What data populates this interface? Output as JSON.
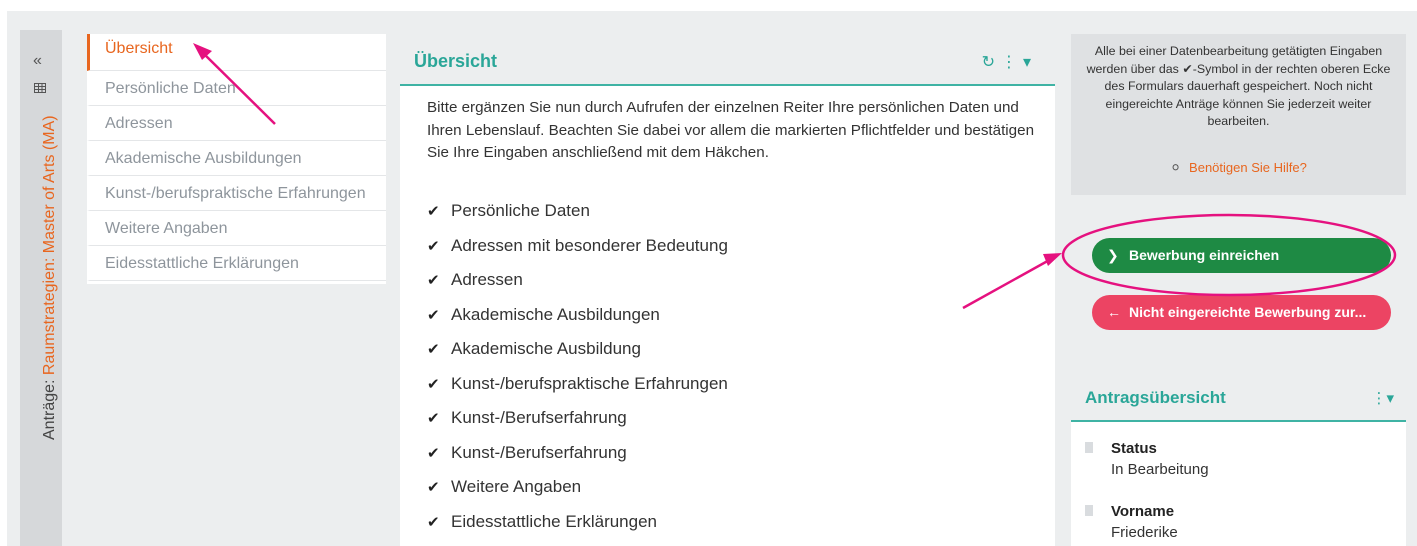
{
  "sidebar": {
    "collapse_icon": "double-chevron-left-icon",
    "grid_icon": "table-icon",
    "applications_label": "Anträge:",
    "program_name": "Raumstrategien: Master of Arts (MA)"
  },
  "nav": {
    "items": [
      {
        "label": "Übersicht",
        "active": true
      },
      {
        "label": "Persönliche Daten",
        "active": false
      },
      {
        "label": "Adressen",
        "active": false
      },
      {
        "label": "Akademische Ausbildungen",
        "active": false
      },
      {
        "label": "Kunst-/berufspraktische Erfahrungen",
        "active": false
      },
      {
        "label": "Weitere Angaben",
        "active": false
      },
      {
        "label": "Eidesstattliche Erklärungen",
        "active": false
      }
    ]
  },
  "main": {
    "title": "Übersicht",
    "tools": {
      "reload_icon": "reload-icon",
      "menu_icon": "kebab-menu-icon"
    },
    "intro": "Bitte ergänzen Sie nun durch Aufrufen der einzelnen Reiter Ihre persönlichen Daten und Ihren Lebenslauf. Beachten Sie dabei vor allem die markierten Pflichtfelder und bestätigen Sie Ihre Eingaben anschließend mit dem Häkchen.",
    "checklist": [
      "Persönliche Daten",
      "Adressen mit besonderer Bedeutung",
      "Adressen",
      "Akademische Ausbildungen",
      "Akademische Ausbildung",
      "Kunst-/berufspraktische Erfahrungen",
      "Kunst-/Berufserfahrung",
      "Kunst-/Berufserfahrung",
      "Weitere Angaben",
      "Eidesstattliche Erklärungen"
    ]
  },
  "info": {
    "text_before": "Alle bei einer Datenbearbeitung getätigten Eingaben werden über das",
    "check_glyph": "✔",
    "text_after": "-Symbol in der rechten oberen Ecke des Formulars dauerhaft gespeichert. Noch nicht eingereichte Anträge können Sie jederzeit weiter bearbeiten.",
    "help_label": "Benötigen Sie Hilfe?"
  },
  "actions": {
    "submit_label": "Bewerbung einreichen",
    "back_label": "Nicht eingereichte Bewerbung zur..."
  },
  "summary": {
    "title": "Antragsübersicht",
    "fields": [
      {
        "label": "Status",
        "value": "In Bearbeitung"
      },
      {
        "label": "Vorname",
        "value": "Friederike"
      }
    ]
  },
  "colors": {
    "accent_teal": "#2aa698",
    "accent_orange": "#e8661f",
    "submit_green": "#1e8a44",
    "back_red": "#ec4463",
    "annotation_pink": "#e5117f"
  }
}
